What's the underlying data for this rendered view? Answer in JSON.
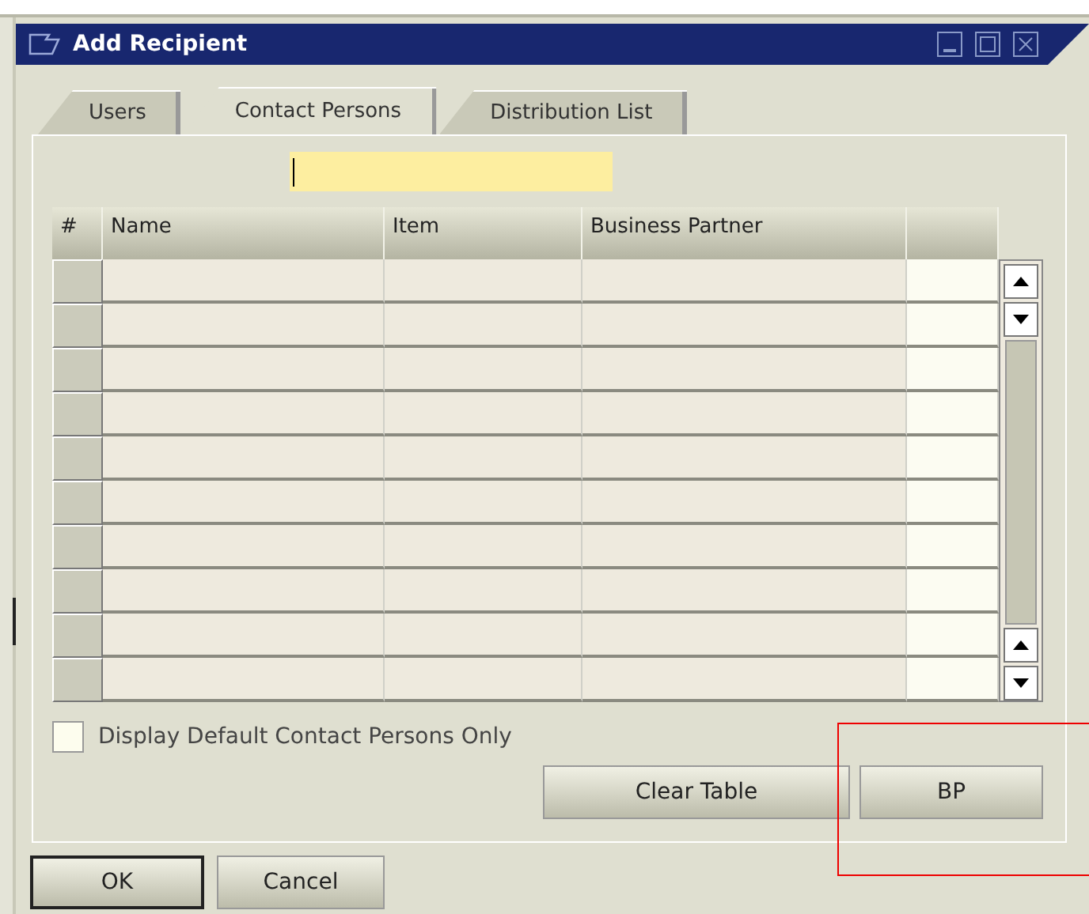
{
  "window": {
    "title": "Add Recipient"
  },
  "tabs": [
    {
      "label": "Users",
      "selected": false
    },
    {
      "label": "Contact Persons",
      "selected": true
    },
    {
      "label": "Distribution List",
      "selected": false
    }
  ],
  "table": {
    "columns": [
      "#",
      "Name",
      "Item",
      "Business Partner"
    ],
    "rows": [
      {
        "selected": false
      },
      {
        "selected": false
      },
      {
        "selected": false
      },
      {
        "selected": false
      },
      {
        "selected": false
      },
      {
        "selected": false
      },
      {
        "selected": false
      },
      {
        "selected": false
      },
      {
        "selected": false
      },
      {
        "selected": false
      }
    ]
  },
  "checkbox": {
    "label": "Display Default Contact Persons Only",
    "checked": false
  },
  "panel_buttons": [
    "Clear Table",
    "BP"
  ],
  "dialog_buttons": [
    {
      "label": "OK",
      "default": true
    },
    {
      "label": "Cancel",
      "default": false
    }
  ],
  "highlight": {
    "visible": true
  }
}
